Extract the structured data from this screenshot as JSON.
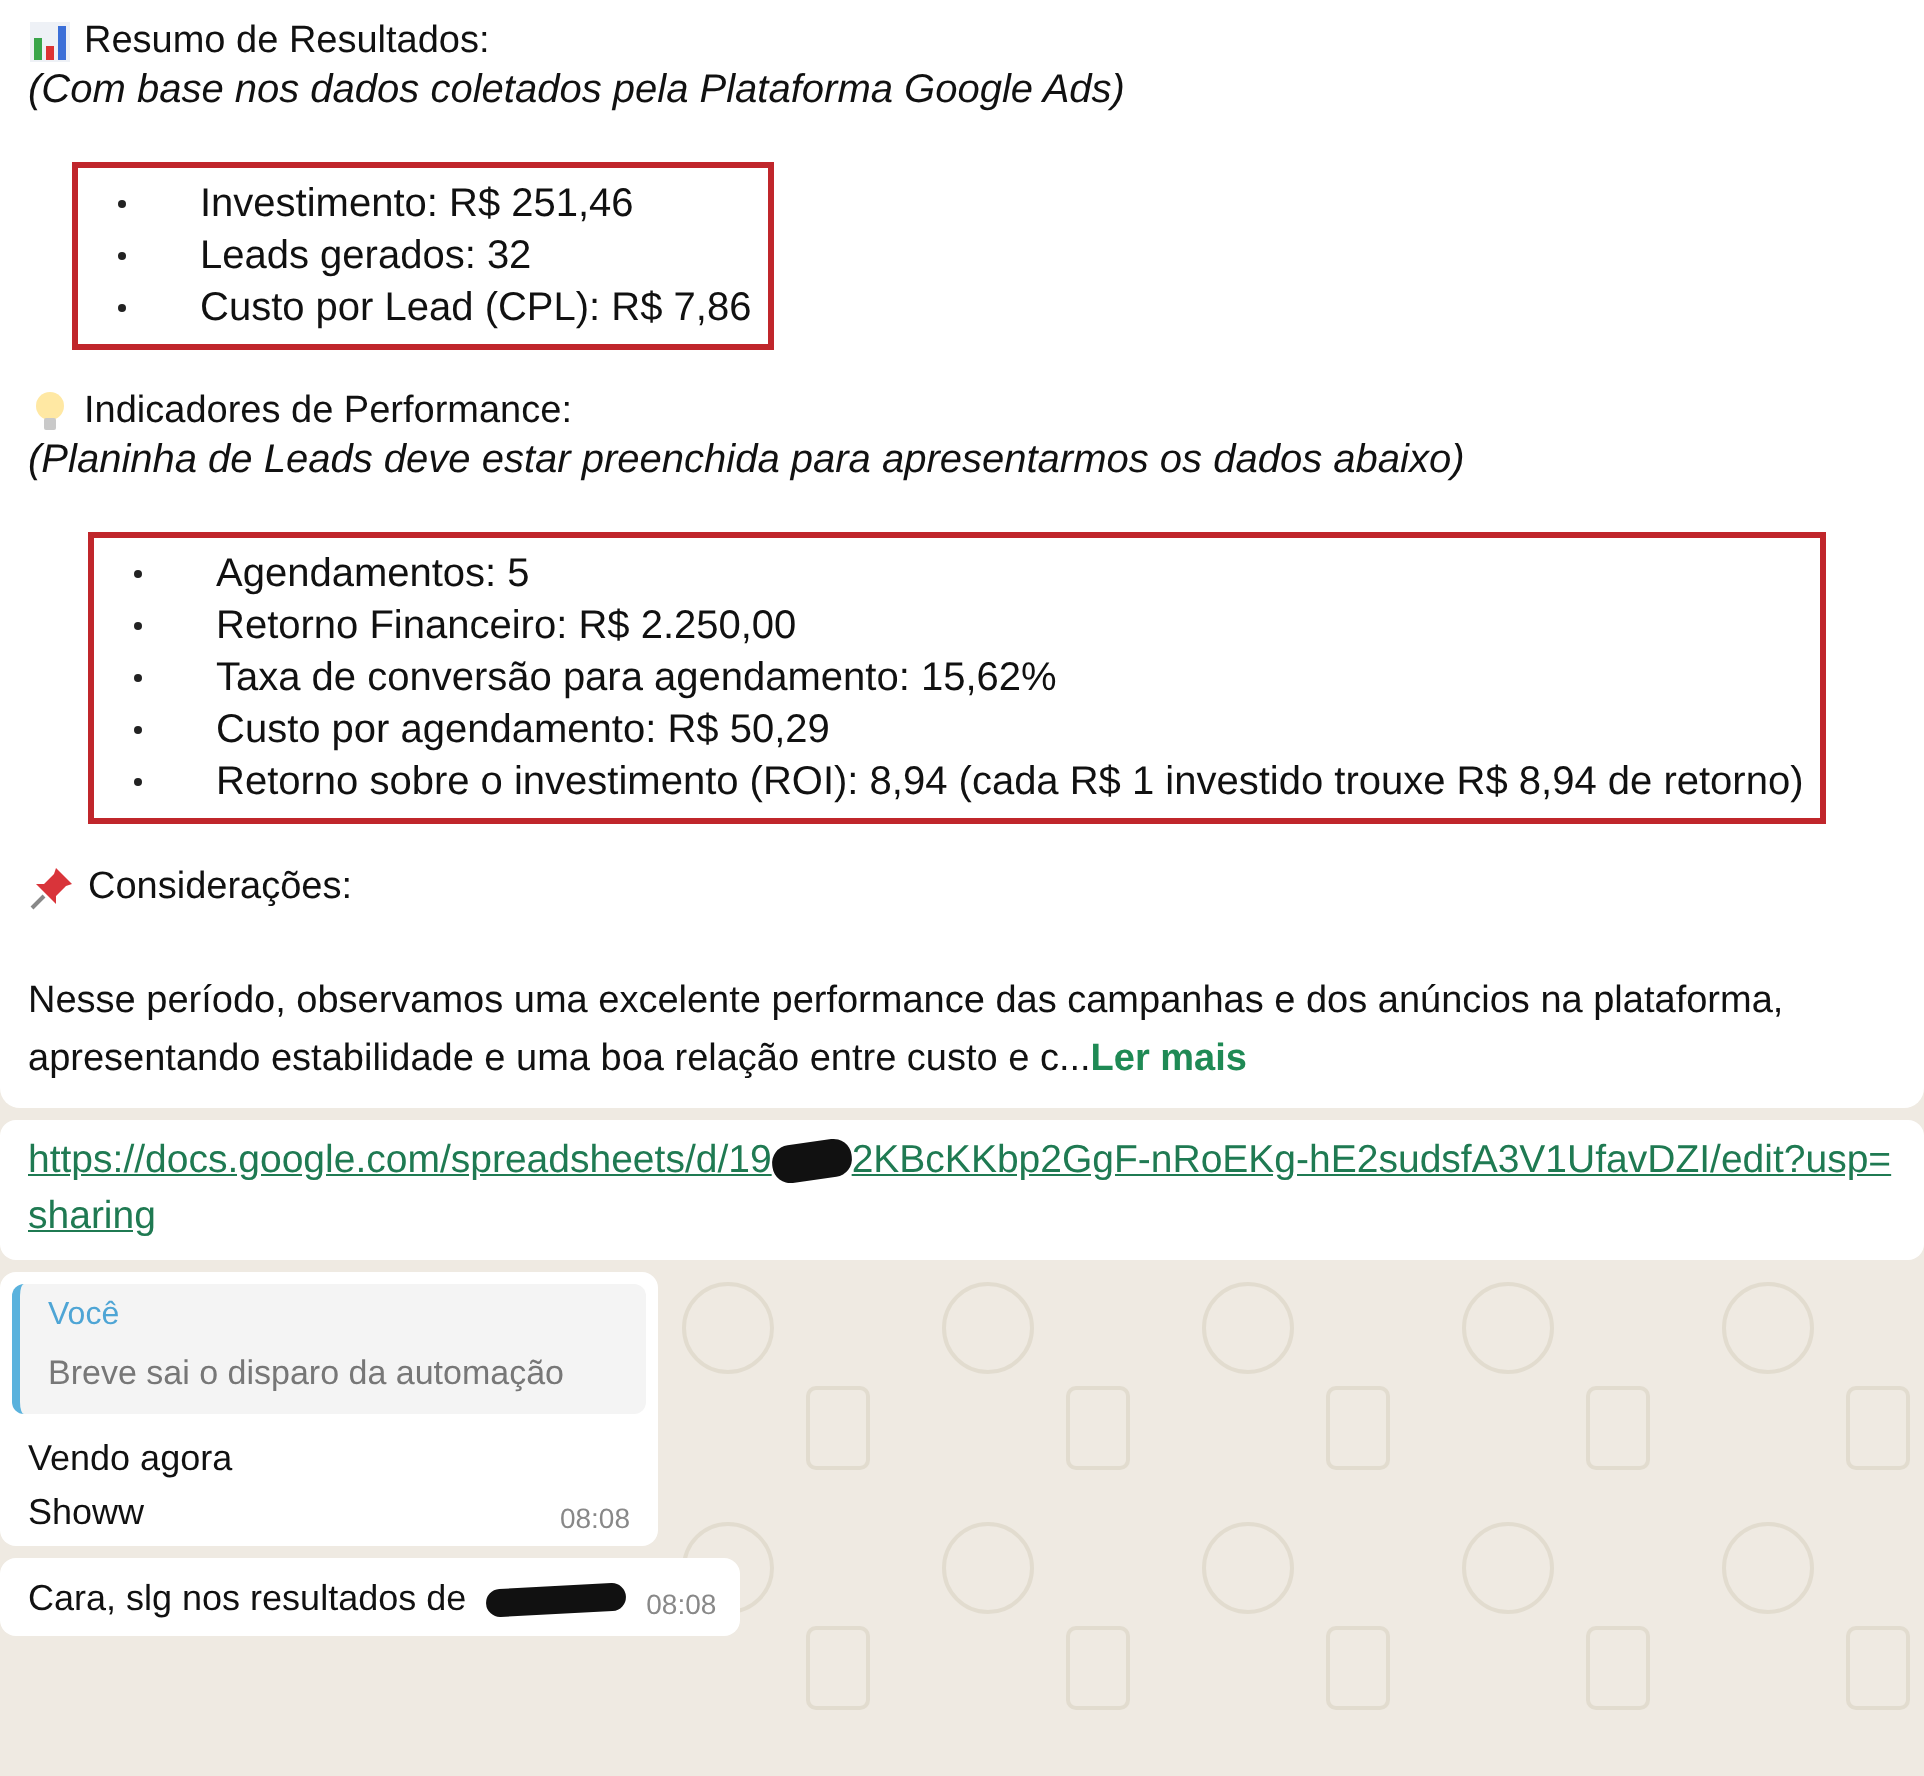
{
  "report_message": {
    "summary_title": "Resumo de Resultados:",
    "summary_note": "(Com base nos dados coletados pela Plataforma Google Ads)",
    "summary_items": [
      "Investimento: R$ 251,46",
      "Leads gerados: 32",
      "Custo por Lead (CPL): R$ 7,86"
    ],
    "performance_title": "Indicadores de Performance:",
    "performance_note": "(Planinha de Leads deve estar preenchida para apresentarmos os dados abaixo)",
    "performance_items": [
      "Agendamentos: 5",
      "Retorno Financeiro: R$ 2.250,00",
      "Taxa de conversão para agendamento: 15,62%",
      "Custo por agendamento: R$ 50,29",
      "Retorno sobre o investimento (ROI): 8,94 (cada R$ 1 investido trouxe R$ 8,94 de retorno)"
    ],
    "considerations_title": "Considerações:",
    "body": "Nesse período, observamos uma excelente performance das campanhas e dos anúncios na plataforma, apresentando estabilidade e uma boa relação entre custo e c...",
    "read_more": "Ler mais"
  },
  "link_message": {
    "link_parts": [
      "https://docs.google.com/spreadsheets/d/19",
      "2KBcKKbp2GgF-nRoEKg-hE2sudsfA3V1UfavDZI/edit?usp=sharing"
    ]
  },
  "reply_message": {
    "quote_author": "Você",
    "quote_text": "Breve sai o disparo da automação",
    "lines": [
      "Vendo agora",
      "Showw"
    ],
    "time": "08:08"
  },
  "last_message": {
    "text": "Cara, slg nos resultados de",
    "time": "08:08"
  }
}
